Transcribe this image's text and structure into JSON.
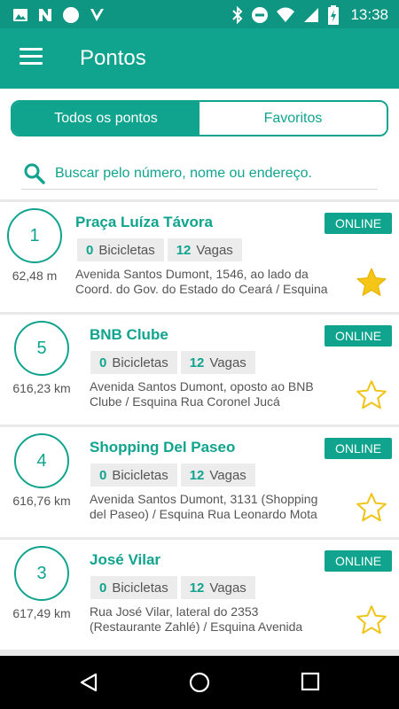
{
  "status": {
    "time": "13:38"
  },
  "appbar": {
    "title": "Pontos"
  },
  "tabs": [
    {
      "label": "Todos os pontos",
      "active": true
    },
    {
      "label": "Favoritos",
      "active": false
    }
  ],
  "search": {
    "placeholder": "Buscar pelo número, nome ou endereço."
  },
  "points": [
    {
      "number": "1",
      "distance": "62,48 m",
      "name": "Praça Luíza Távora",
      "status": "ONLINE",
      "bikes_count": "0",
      "bikes_label": "Bicicletas",
      "slots_count": "12",
      "slots_label": "Vagas",
      "address_line1": "Avenida Santos Dumont, 1546, ao lado da",
      "address_line2": "Coord. do Gov. do Estado do Ceará / Esquina",
      "favorite": true
    },
    {
      "number": "5",
      "distance": "616,23 km",
      "name": "BNB Clube",
      "status": "ONLINE",
      "bikes_count": "0",
      "bikes_label": "Bicicletas",
      "slots_count": "12",
      "slots_label": "Vagas",
      "address_line1": "Avenida Santos Dumont, oposto ao BNB",
      "address_line2": "Clube / Esquina Rua Coronel Jucá",
      "favorite": false
    },
    {
      "number": "4",
      "distance": "616,76 km",
      "name": "Shopping Del Paseo",
      "status": "ONLINE",
      "bikes_count": "0",
      "bikes_label": "Bicicletas",
      "slots_count": "12",
      "slots_label": "Vagas",
      "address_line1": "Avenida Santos Dumont, 3131 (Shopping",
      "address_line2": "del Paseo) / Esquina Rua Leonardo Mota",
      "favorite": false
    },
    {
      "number": "3",
      "distance": "617,49 km",
      "name": "José Vilar",
      "status": "ONLINE",
      "bikes_count": "0",
      "bikes_label": "Bicicletas",
      "slots_count": "12",
      "slots_label": "Vagas",
      "address_line1": "Rua José Vilar, lateral do 2353",
      "address_line2": "(Restaurante Zahlé) / Esquina Avenida",
      "favorite": false
    }
  ],
  "colors": {
    "primary": "#10a48e",
    "status_bar": "#0f9683",
    "star_filled": "#f5c518",
    "star_outline": "#f0c419"
  },
  "icons": {
    "menu": "hamburger-icon",
    "search": "search-icon",
    "favorite": "star-icon",
    "back": "back-triangle-icon",
    "home": "home-circle-icon",
    "recents": "recents-square-icon"
  }
}
